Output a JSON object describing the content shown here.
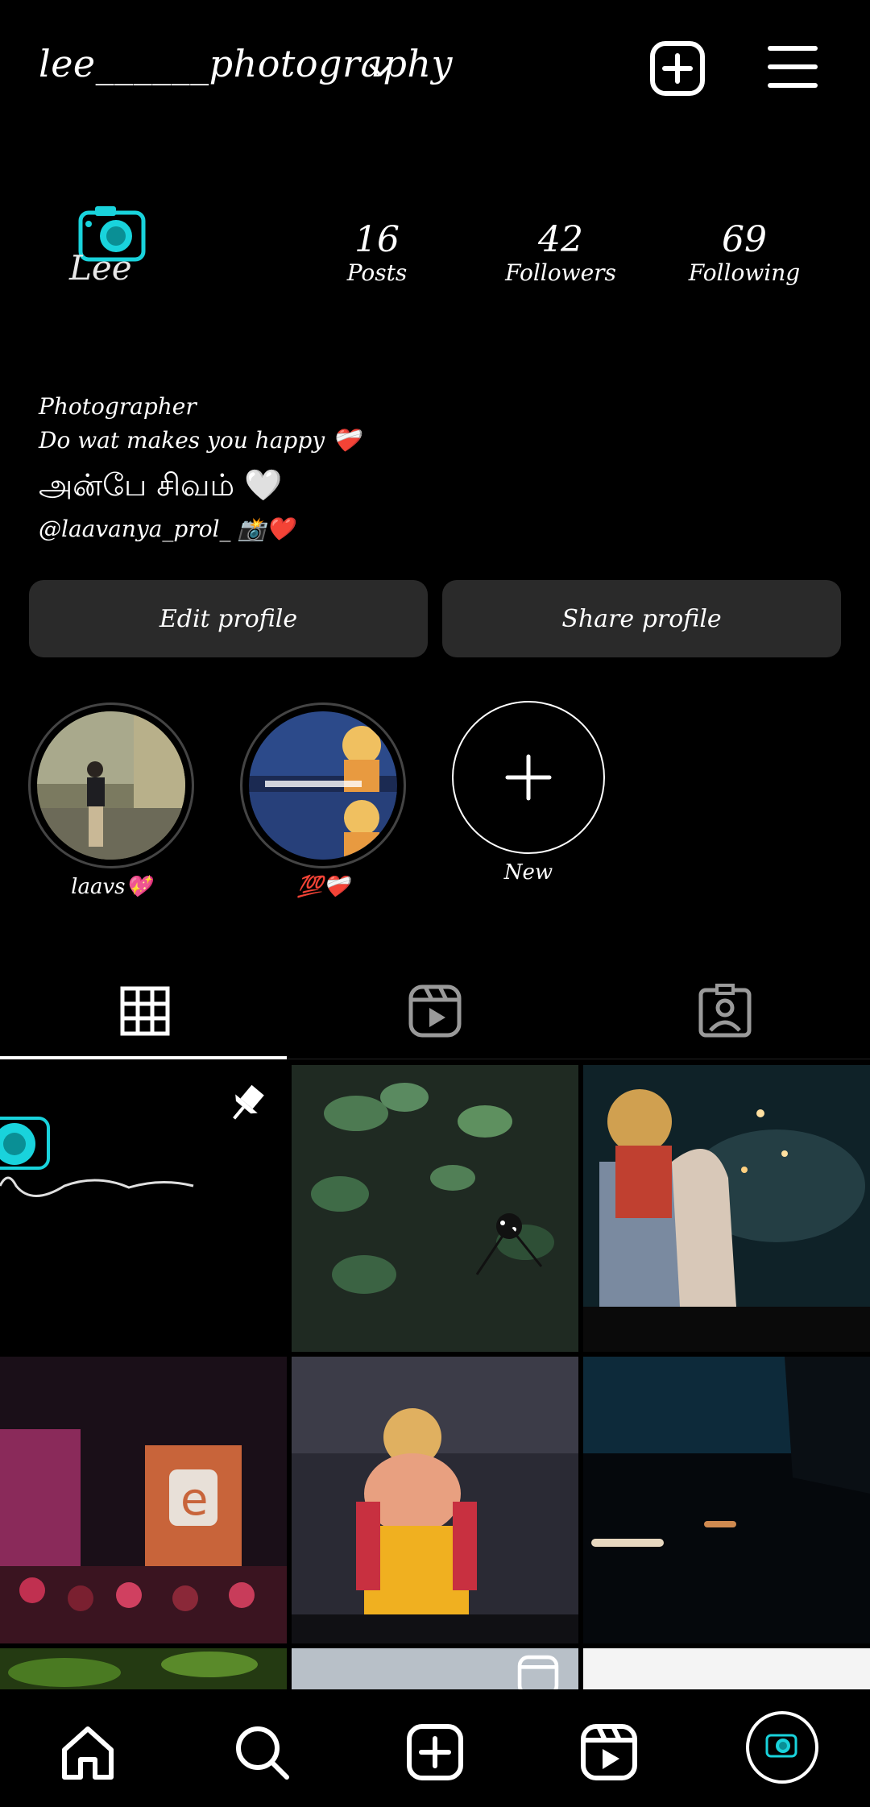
{
  "header": {
    "username": "lee______photography",
    "icons": [
      "chevron-down-icon",
      "create-post-icon",
      "menu-icon"
    ]
  },
  "profile": {
    "avatar_text": "Lee",
    "stats": [
      {
        "value": "16",
        "label": "Posts"
      },
      {
        "value": "42",
        "label": "Followers"
      },
      {
        "value": "69",
        "label": "Following"
      }
    ],
    "bio": {
      "line1": "Photographer",
      "line2": "Do wat makes you happy ❤️‍🩹",
      "line3": "அன்பே சிவம் 🤍",
      "line4": "@laavanya_prol_   📸❤️"
    }
  },
  "actions": {
    "edit": "Edit profile",
    "share": "Share profile"
  },
  "highlights": [
    {
      "label": "laavs💖"
    },
    {
      "label": "💯❤️‍🩹"
    },
    {
      "label": "New"
    }
  ],
  "tabs": [
    "grid-icon",
    "reels-icon",
    "tagged-icon"
  ],
  "posts": {
    "pinned_logo_text": "Photography",
    "ganesh_caption": "",
    "colors": {
      "accent": "#19d3dc"
    }
  },
  "bottom_nav": [
    "home-icon",
    "search-icon",
    "create-icon",
    "reels-icon",
    "profile-avatar"
  ]
}
